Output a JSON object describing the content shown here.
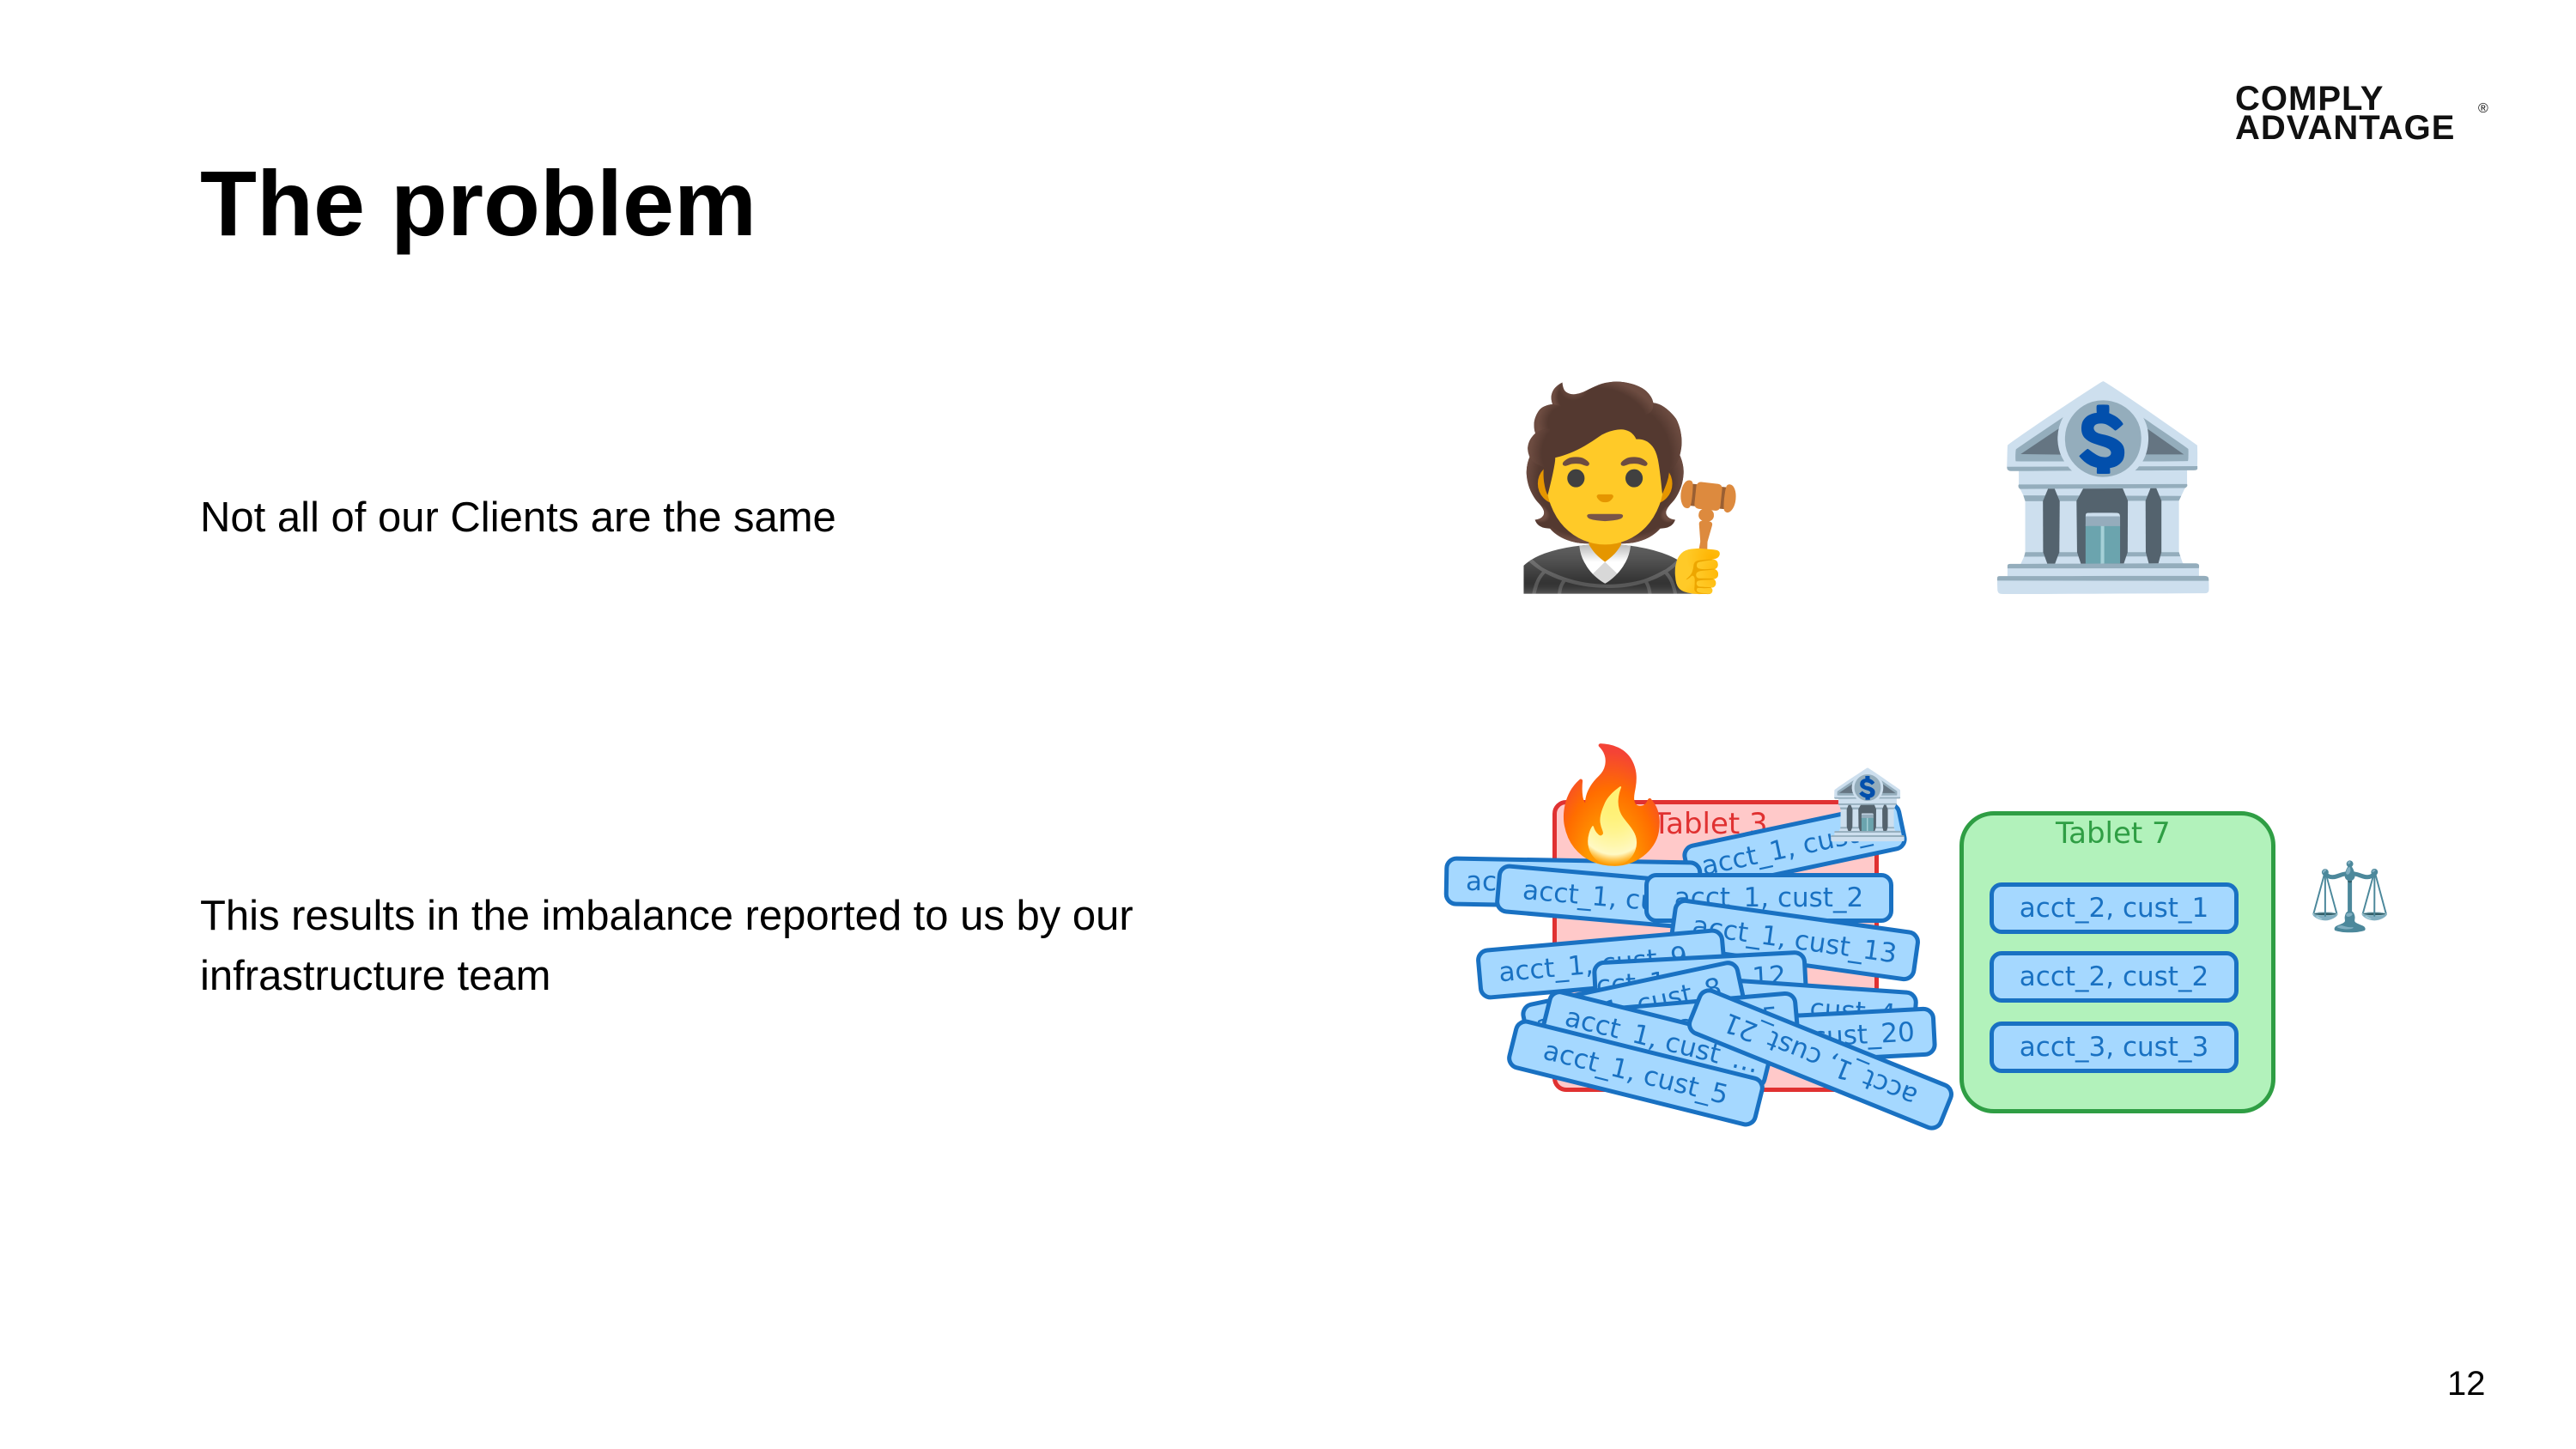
{
  "slide": {
    "title": "The problem",
    "page_number": "12",
    "logo": {
      "line1": "COMPLY",
      "line2": "ADVANTAGE",
      "registered_mark": "®"
    },
    "points": [
      {
        "text": "Not all of our Clients are the same"
      },
      {
        "text": "This results in the imbalance reported to us by our infrastructure team"
      }
    ]
  },
  "icons": {
    "judge": "🧑‍⚖️",
    "bank": "🏦",
    "fire": "🔥",
    "small_bank": "🏦",
    "scales": "⚖️"
  },
  "diagram": {
    "tablet3": {
      "label": "Tablet 3",
      "colors": {
        "fill": "#ffc9c9",
        "stroke": "#e03131"
      },
      "cards": [
        "acct_1, cust_1",
        "acct_1, cust_…",
        "acct_1, cust_…",
        "acct_1, cust_2",
        "acct_1, cust_13",
        "acct_1, cust_9",
        "acct_1, cust_12",
        "acct_1, cust_8",
        "acct_1, cust_4",
        "acct_1, cust_15",
        "acct_1, cust_20",
        "acct_1, cust_…",
        "acct_1, cust_21",
        "acct_1, cust_5"
      ]
    },
    "tablet7": {
      "label": "Tablet 7",
      "colors": {
        "fill": "#b2f2bb",
        "stroke": "#2f9e44"
      },
      "cards": [
        "acct_2, cust_1",
        "acct_2, cust_2",
        "acct_3, cust_3"
      ]
    },
    "card_colors": {
      "fill": "#a5d8ff",
      "stroke": "#1971c2"
    }
  }
}
